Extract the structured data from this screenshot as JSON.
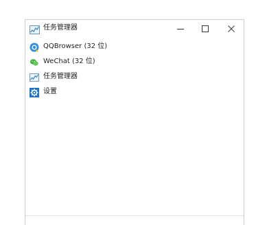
{
  "window": {
    "title": "任务管理器",
    "controls": {
      "minimize_icon": "minimize-icon",
      "maximize_icon": "maximize-icon",
      "close_icon": "close-icon"
    }
  },
  "items": [
    {
      "label": "QQBrowser (32 位)",
      "icon": "qqbrowser-icon"
    },
    {
      "label": "WeChat (32 位)",
      "icon": "wechat-icon"
    },
    {
      "label": "任务管理器",
      "icon": "task-manager-icon"
    },
    {
      "label": "设置",
      "icon": "settings-icon"
    }
  ],
  "colors": {
    "qqbrowser": "#2f8fd8",
    "wechat": "#3cb034",
    "settings": "#1a73c9"
  }
}
